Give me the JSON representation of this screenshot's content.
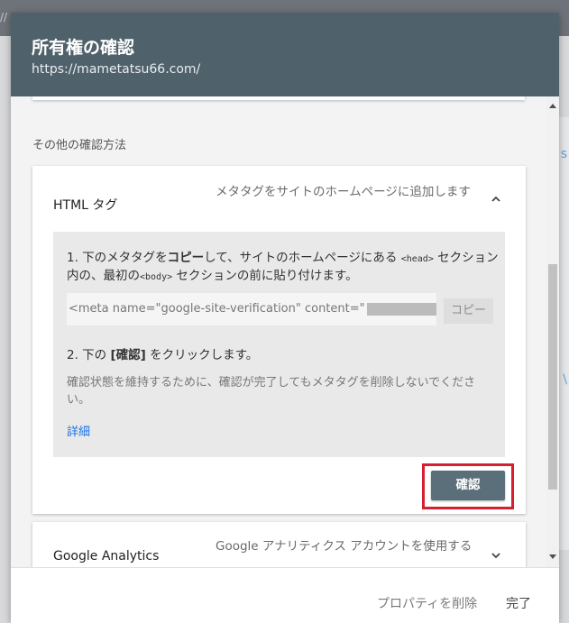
{
  "dialog": {
    "title": "所有権の確認",
    "url": "https://mametatsu66.com/"
  },
  "section_label": "その他の確認方法",
  "methods": [
    {
      "name": "HTML タグ",
      "description": "メタタグをサイトのホームページに追加します",
      "expanded": true,
      "instructions": {
        "step1_prefix": "1. 下のメタタグを",
        "step1_bold": "コピー",
        "step1_mid": "して、サイトのホームページにある",
        "step1_head_tag": "<head>",
        "step1_mid2": "セクション内の、最初の",
        "step1_body_tag": "<body>",
        "step1_suffix": "セクションの前に貼り付けます。",
        "meta_tag": "<meta name=\"google-site-verification\" content=\"",
        "copy_label": "コピー",
        "step2_prefix": "2. 下の",
        "step2_bold": "[確認]",
        "step2_suffix": "をクリックします。",
        "note": "確認状態を維持するために、確認が完了してもメタタグを削除しないでください。",
        "details_link": "詳細"
      },
      "confirm_label": "確認"
    },
    {
      "name": "Google Analytics",
      "description": "Google アナリティクス アカウントを使用する",
      "expanded": false
    }
  ],
  "footer": {
    "delete_label": "プロパティを削除",
    "done_label": "完了"
  },
  "colors": {
    "header_bg": "#4f616b",
    "confirm_bg": "#5b6f7a",
    "highlight": "#d62030",
    "link": "#1a73e8"
  },
  "icons": {
    "html_chevron": "chevron-up-icon",
    "ga_chevron": "chevron-down-icon"
  }
}
